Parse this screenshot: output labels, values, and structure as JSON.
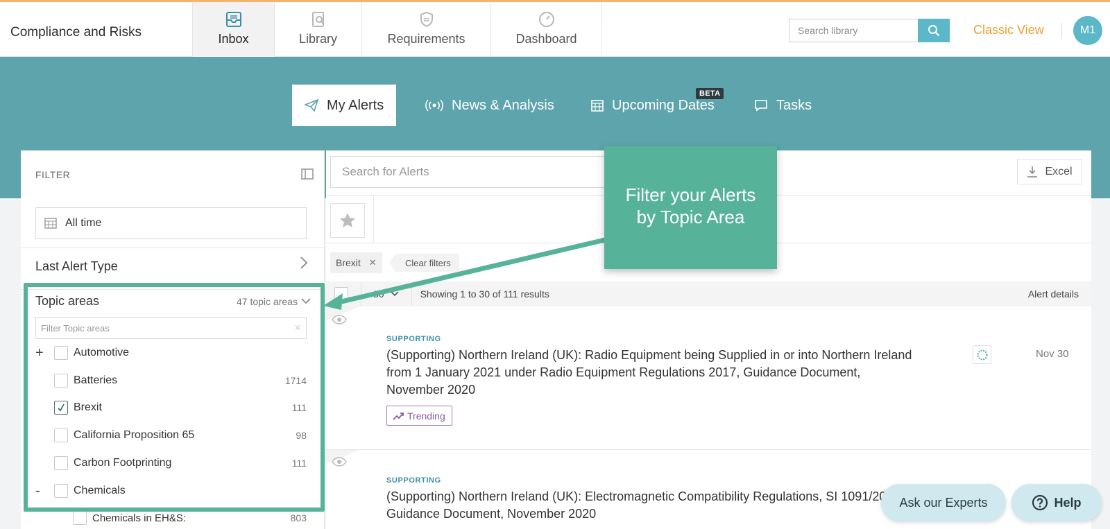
{
  "app": {
    "title": "Compliance and Risks"
  },
  "nav": {
    "tabs": [
      {
        "label": "Inbox",
        "icon": "inbox-icon",
        "active": true
      },
      {
        "label": "Library",
        "icon": "library-icon",
        "active": false
      },
      {
        "label": "Requirements",
        "icon": "shield-icon",
        "active": false
      },
      {
        "label": "Dashboard",
        "icon": "gauge-icon",
        "active": false
      }
    ]
  },
  "header": {
    "search_placeholder": "Search library",
    "classic_view": "Classic View",
    "avatar_initials": "M1"
  },
  "subnav": {
    "tabs": [
      {
        "label": "My Alerts",
        "icon": "paper-plane-icon",
        "active": true
      },
      {
        "label": "News & Analysis",
        "icon": "broadcast-icon",
        "active": false
      },
      {
        "label": "Upcoming Dates",
        "icon": "calendar-icon",
        "active": false,
        "badge": "BETA"
      },
      {
        "label": "Tasks",
        "icon": "chat-bubble-icon",
        "active": false
      }
    ]
  },
  "filter": {
    "title": "FILTER",
    "date_range": "All time",
    "last_alert_type": "Last Alert Type",
    "topic_areas": {
      "label": "Topic areas",
      "count_label": "47 topic areas",
      "filter_placeholder": "Filter Topic areas",
      "items": [
        {
          "name": "Automotive",
          "count": "",
          "checked": false,
          "expander": "+"
        },
        {
          "name": "Batteries",
          "count": "1714",
          "checked": false,
          "expander": ""
        },
        {
          "name": "Brexit",
          "count": "111",
          "checked": true,
          "expander": ""
        },
        {
          "name": "California Proposition 65",
          "count": "98",
          "checked": false,
          "expander": ""
        },
        {
          "name": "Carbon Footprinting",
          "count": "111",
          "checked": false,
          "expander": ""
        },
        {
          "name": "Chemicals",
          "count": "",
          "checked": false,
          "expander": "-"
        }
      ],
      "subitems": [
        {
          "name": "Chemicals in EH&S:",
          "count": "803",
          "checked": false
        }
      ]
    }
  },
  "main": {
    "search_placeholder": "Search for Alerts",
    "excel_label": "Excel",
    "active_filter": "Brexit",
    "clear_filters": "Clear filters",
    "per_page": "30",
    "showing": "Showing 1 to 30 of 111 results",
    "alert_details": "Alert details",
    "alerts": [
      {
        "category": "SUPPORTING",
        "title": "(Supporting) Northern Ireland (UK): Radio Equipment being Supplied in or into Northern Ireland from 1 January 2021 under Radio Equipment Regulations 2017, Guidance Document, November 2020",
        "tag": "Trending",
        "date": "Nov 30"
      },
      {
        "category": "SUPPORTING",
        "title": "(Supporting) Northern Ireland (UK): Electromagnetic Compatibility Regulations, SI 1091/2016, Guidance Document, November 2020",
        "tag": "",
        "date": ""
      }
    ]
  },
  "callout": {
    "line1": "Filter your Alerts",
    "line2": "by Topic Area"
  },
  "fabs": {
    "ask": "Ask our Experts",
    "help": "Help"
  },
  "colors": {
    "accent": "#5cb8c8",
    "band": "#5ea4ad",
    "callout": "#56b39a",
    "classic": "#e8a12f",
    "trend": "#8a5aa3"
  }
}
